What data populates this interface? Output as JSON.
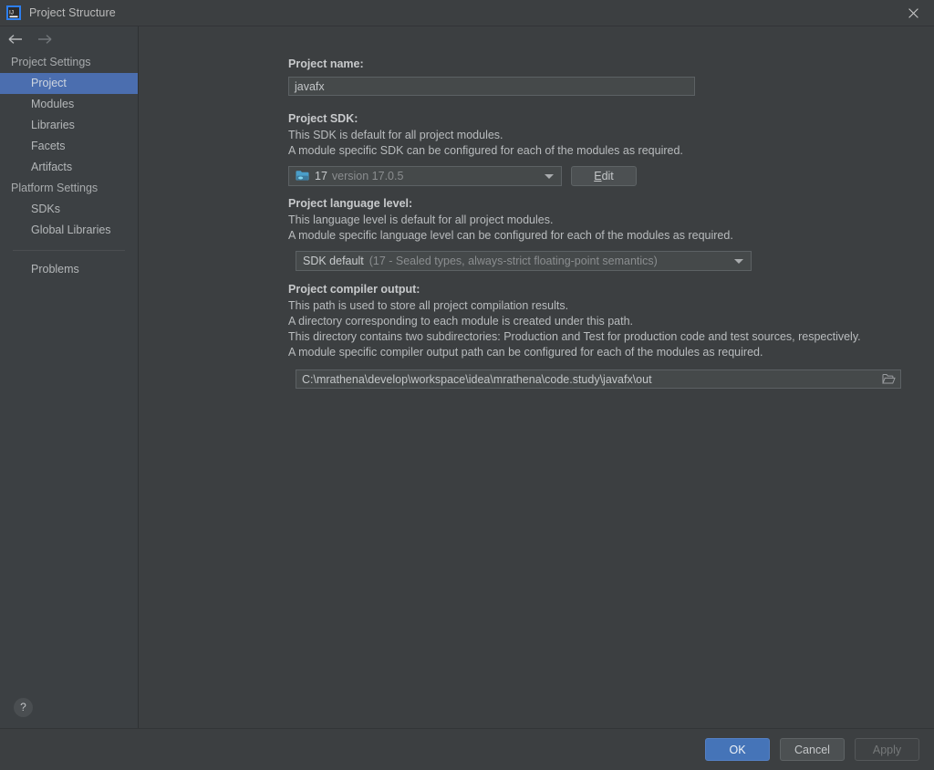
{
  "window": {
    "title": "Project Structure",
    "app_icon": "intellij-idea-icon",
    "close_icon": "close-icon"
  },
  "nav": {
    "back_icon": "arrow-left-icon",
    "forward_icon": "arrow-right-icon"
  },
  "sidebar": {
    "groups": [
      {
        "label": "Project Settings",
        "items": [
          {
            "label": "Project",
            "selected": true
          },
          {
            "label": "Modules",
            "selected": false
          },
          {
            "label": "Libraries",
            "selected": false
          },
          {
            "label": "Facets",
            "selected": false
          },
          {
            "label": "Artifacts",
            "selected": false
          }
        ]
      },
      {
        "label": "Platform Settings",
        "items": [
          {
            "label": "SDKs",
            "selected": false
          },
          {
            "label": "Global Libraries",
            "selected": false
          }
        ]
      }
    ],
    "problems_label": "Problems",
    "help_label": "?",
    "help_icon": "help-icon",
    "selected_color": "#4b6eaf"
  },
  "main": {
    "project_name": {
      "label": "Project name:",
      "value": "javafx"
    },
    "project_sdk": {
      "label": "Project SDK:",
      "desc1": "This SDK is default for all project modules.",
      "desc2": "A module specific SDK can be configured for each of the modules as required.",
      "sdk_icon": "jdk-folder-icon",
      "value_bright": "17",
      "value_dim": "version 17.0.5",
      "dropdown_icon": "chevron-down-icon",
      "edit_button": {
        "prefix": "E",
        "rest": "dit"
      }
    },
    "language_level": {
      "label": "Project language level:",
      "desc1": "This language level is default for all project modules.",
      "desc2": "A module specific language level can be configured for each of the modules as required.",
      "value_bright": "SDK default",
      "value_dim": "(17 - Sealed types, always-strict floating-point semantics)",
      "dropdown_icon": "chevron-down-icon"
    },
    "compiler_output": {
      "label": "Project compiler output:",
      "desc1": "This path is used to store all project compilation results.",
      "desc2": "A directory corresponding to each module is created under this path.",
      "desc3": "This directory contains two subdirectories: Production and Test for production code and test sources, respectively.",
      "desc4": "A module specific compiler output path can be configured for each of the modules as required.",
      "value": "C:\\mrathena\\develop\\workspace\\idea\\mrathena\\code.study\\javafx\\out",
      "browse_icon": "folder-open-icon"
    }
  },
  "footer": {
    "ok": "OK",
    "cancel": "Cancel",
    "apply": "Apply",
    "primary_color": "#4574b8"
  }
}
